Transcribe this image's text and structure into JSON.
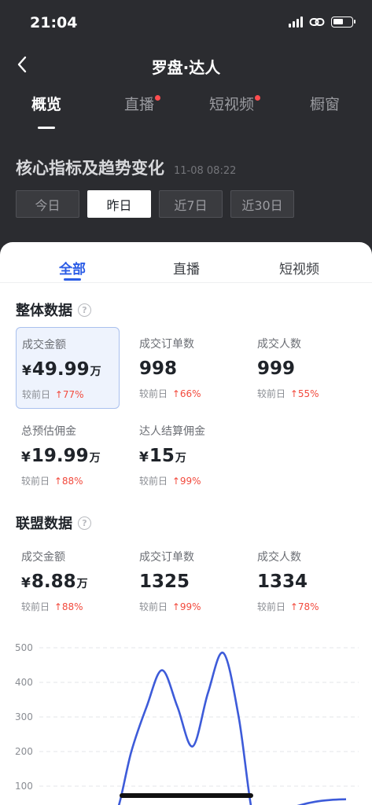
{
  "status_bar": {
    "time": "21:04"
  },
  "nav": {
    "title": "罗盘·达人"
  },
  "top_tabs": [
    {
      "label": "概览",
      "active": true,
      "dot": false
    },
    {
      "label": "直播",
      "active": false,
      "dot": true
    },
    {
      "label": "短视频",
      "active": false,
      "dot": true
    },
    {
      "label": "橱窗",
      "active": false,
      "dot": false
    }
  ],
  "section": {
    "title": "核心指标及趋势变化",
    "updated": "11-08 08:22"
  },
  "date_tabs": [
    {
      "label": "今日",
      "active": false
    },
    {
      "label": "昨日",
      "active": true
    },
    {
      "label": "近7日",
      "active": false
    },
    {
      "label": "近30日",
      "active": false
    }
  ],
  "sub_tabs": [
    {
      "label": "全部",
      "active": true
    },
    {
      "label": "直播",
      "active": false
    },
    {
      "label": "短视频",
      "active": false
    }
  ],
  "overall": {
    "title": "整体数据",
    "help": "?",
    "compare_label": "较前日",
    "metrics": [
      {
        "label": "成交金额",
        "currency": "¥",
        "value": "49.99",
        "unit": "万",
        "change": "77%"
      },
      {
        "label": "成交订单数",
        "currency": "",
        "value": "998",
        "unit": "",
        "change": "66%"
      },
      {
        "label": "成交人数",
        "currency": "",
        "value": "999",
        "unit": "",
        "change": "55%"
      },
      {
        "label": "总预估佣金",
        "currency": "¥",
        "value": "19.99",
        "unit": "万",
        "change": "88%"
      },
      {
        "label": "达人结算佣金",
        "currency": "¥",
        "value": "15",
        "unit": "万",
        "change": "99%"
      }
    ]
  },
  "alliance": {
    "title": "联盟数据",
    "help": "?",
    "compare_label": "较前日",
    "metrics": [
      {
        "label": "成交金额",
        "currency": "¥",
        "value": "8.88",
        "unit": "万",
        "change": "88%"
      },
      {
        "label": "成交订单数",
        "currency": "",
        "value": "1325",
        "unit": "",
        "change": "99%"
      },
      {
        "label": "成交人数",
        "currency": "",
        "value": "1334",
        "unit": "",
        "change": "78%"
      }
    ]
  },
  "chart_data": {
    "type": "line",
    "y_ticks": [
      100,
      200,
      300,
      400,
      500
    ],
    "ylim": [
      0,
      500
    ],
    "grid": true,
    "series": [
      {
        "color": "#3d5bd9",
        "x": [
          0,
          1,
          2,
          3,
          4,
          5,
          6,
          7,
          8,
          9,
          10,
          11,
          12,
          13,
          14,
          15,
          16,
          17,
          18,
          19,
          20
        ],
        "y": [
          0,
          0,
          0,
          0,
          0,
          20,
          200,
          330,
          435,
          330,
          215,
          370,
          485,
          300,
          0,
          0,
          30,
          45,
          55,
          60,
          62
        ]
      }
    ]
  },
  "colors": {
    "accent": "#2b5ce6",
    "up": "#f24a3d",
    "line": "#3d5bd9"
  }
}
